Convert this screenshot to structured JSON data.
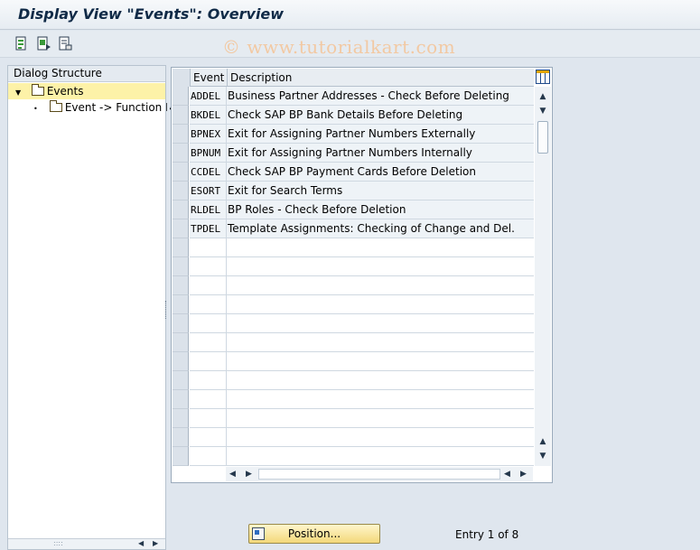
{
  "window": {
    "title": "Display View \"Events\": Overview"
  },
  "watermark": "© www.tutorialkart.com",
  "toolbar": {
    "icons": [
      "details-icon",
      "next-entry-icon",
      "print-icon"
    ]
  },
  "dialog_structure": {
    "header": "Dialog Structure",
    "items": [
      {
        "label": "Events",
        "level": 0,
        "expanded": true,
        "selected": true
      },
      {
        "label": "Event -> Function M",
        "level": 1,
        "expanded": false,
        "selected": false
      }
    ]
  },
  "table": {
    "columns": [
      "Event",
      "Description"
    ],
    "rows": [
      {
        "event": "ADDEL",
        "description": "Business Partner Addresses - Check Before Deleting"
      },
      {
        "event": "BKDEL",
        "description": "Check SAP BP Bank Details Before Deleting"
      },
      {
        "event": "BPNEX",
        "description": "Exit for Assigning Partner Numbers Externally"
      },
      {
        "event": "BPNUM",
        "description": "Exit for Assigning Partner Numbers Internally"
      },
      {
        "event": "CCDEL",
        "description": "Check SAP BP Payment Cards Before Deletion"
      },
      {
        "event": "ESORT",
        "description": "Exit for Search Terms"
      },
      {
        "event": "RLDEL",
        "description": "BP Roles - Check Before Deletion"
      },
      {
        "event": "TPDEL",
        "description": "Template Assignments: Checking of Change and Del."
      }
    ],
    "empty_rows": 12
  },
  "footer": {
    "position_button": "Position...",
    "entry_text": "Entry 1 of 8"
  }
}
